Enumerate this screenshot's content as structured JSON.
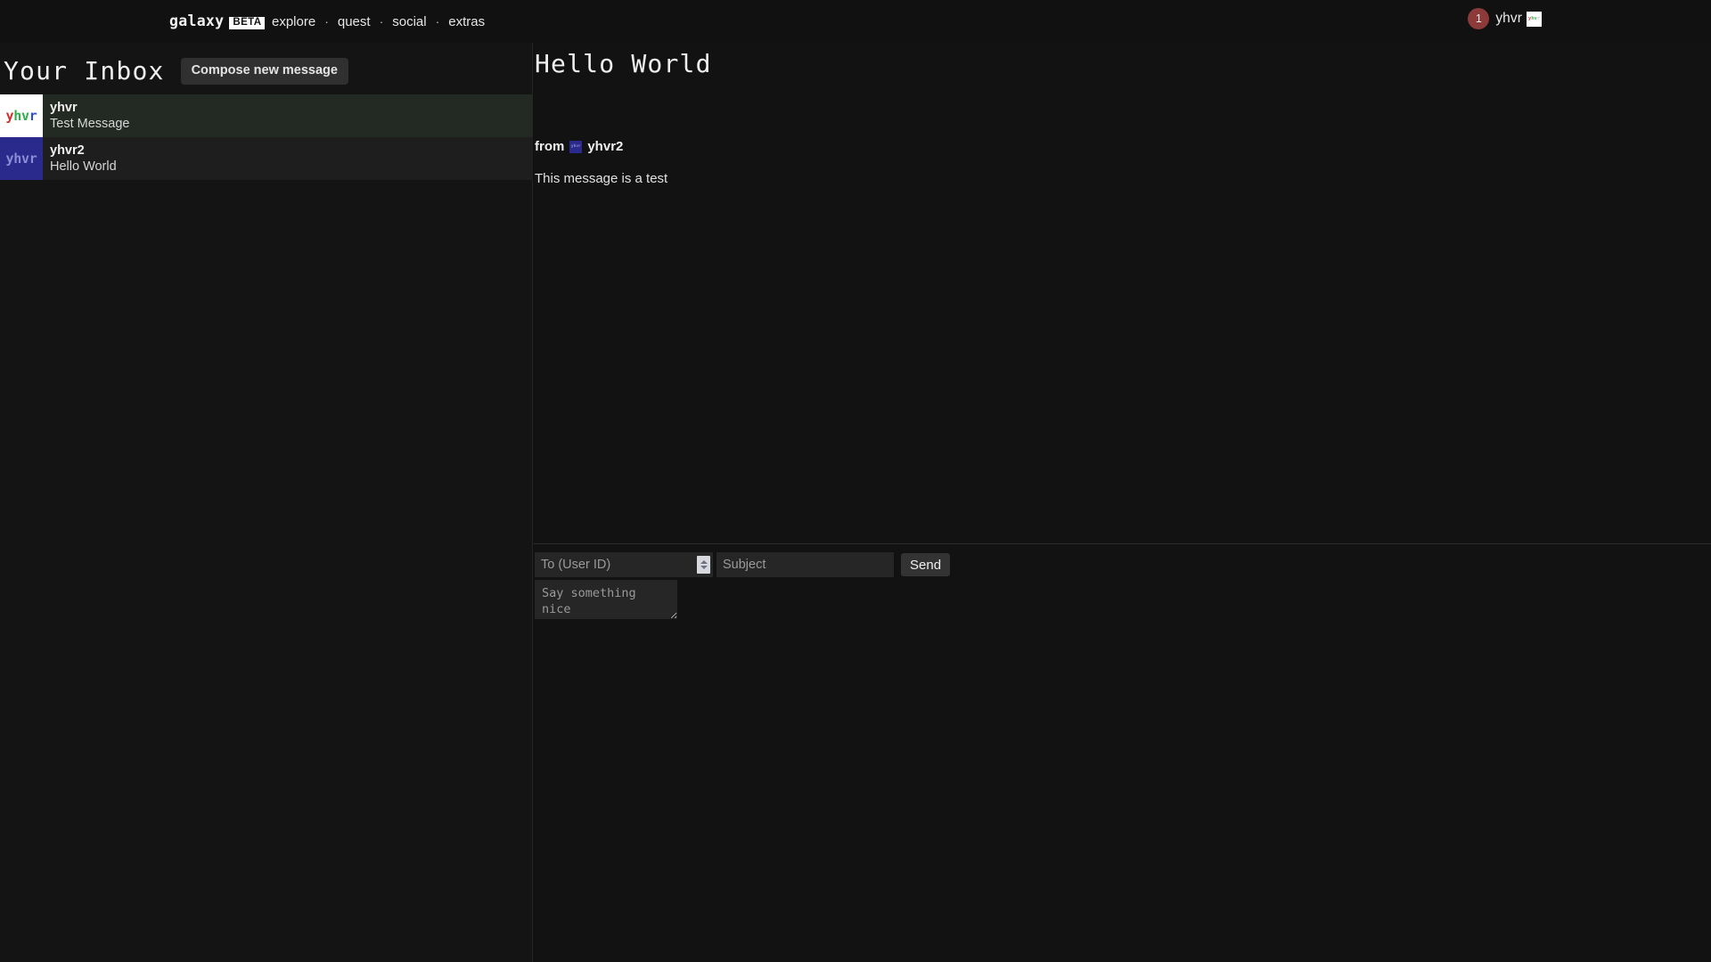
{
  "nav": {
    "brand": "galaxy",
    "brand_tag": "BETA",
    "links": [
      {
        "label": "explore"
      },
      {
        "label": "quest"
      },
      {
        "label": "social"
      },
      {
        "label": "extras"
      }
    ],
    "separator": "·",
    "user": {
      "notification_count": "1",
      "username": "yhvr",
      "avatar_letters": [
        "y",
        "hv",
        "r"
      ]
    }
  },
  "inbox": {
    "title": "Your Inbox",
    "compose_label": "Compose new message",
    "messages": [
      {
        "sender": "yhvr",
        "subject": "Test Message",
        "avatar_letters": [
          "y",
          "hv",
          "r"
        ],
        "avatar_style": "light",
        "state": "unread"
      },
      {
        "sender": "yhvr2",
        "subject": "Hello World",
        "avatar_letters": [
          "y",
          "hv",
          "r"
        ],
        "avatar_style": "indigo",
        "state": "read"
      }
    ]
  },
  "message": {
    "title": "Hello World",
    "from_label": "from",
    "from_user": "yhvr2",
    "from_avatar_text": "yhvr",
    "body": "This message is a test"
  },
  "compose": {
    "to_placeholder": "To (User ID)",
    "to_value": "",
    "subject_placeholder": "Subject",
    "subject_value": "",
    "body_placeholder": "Say something nice",
    "body_value": "",
    "send_label": "Send"
  },
  "colors": {
    "page_bg": "#111111",
    "panel_bg": "#141414",
    "unread_row": "#232a23",
    "read_row": "#1e1e1e",
    "badge_red": "#8c3a3a",
    "avatar_indigo": "#2a2a8c",
    "accent_white": "#ffffff"
  }
}
